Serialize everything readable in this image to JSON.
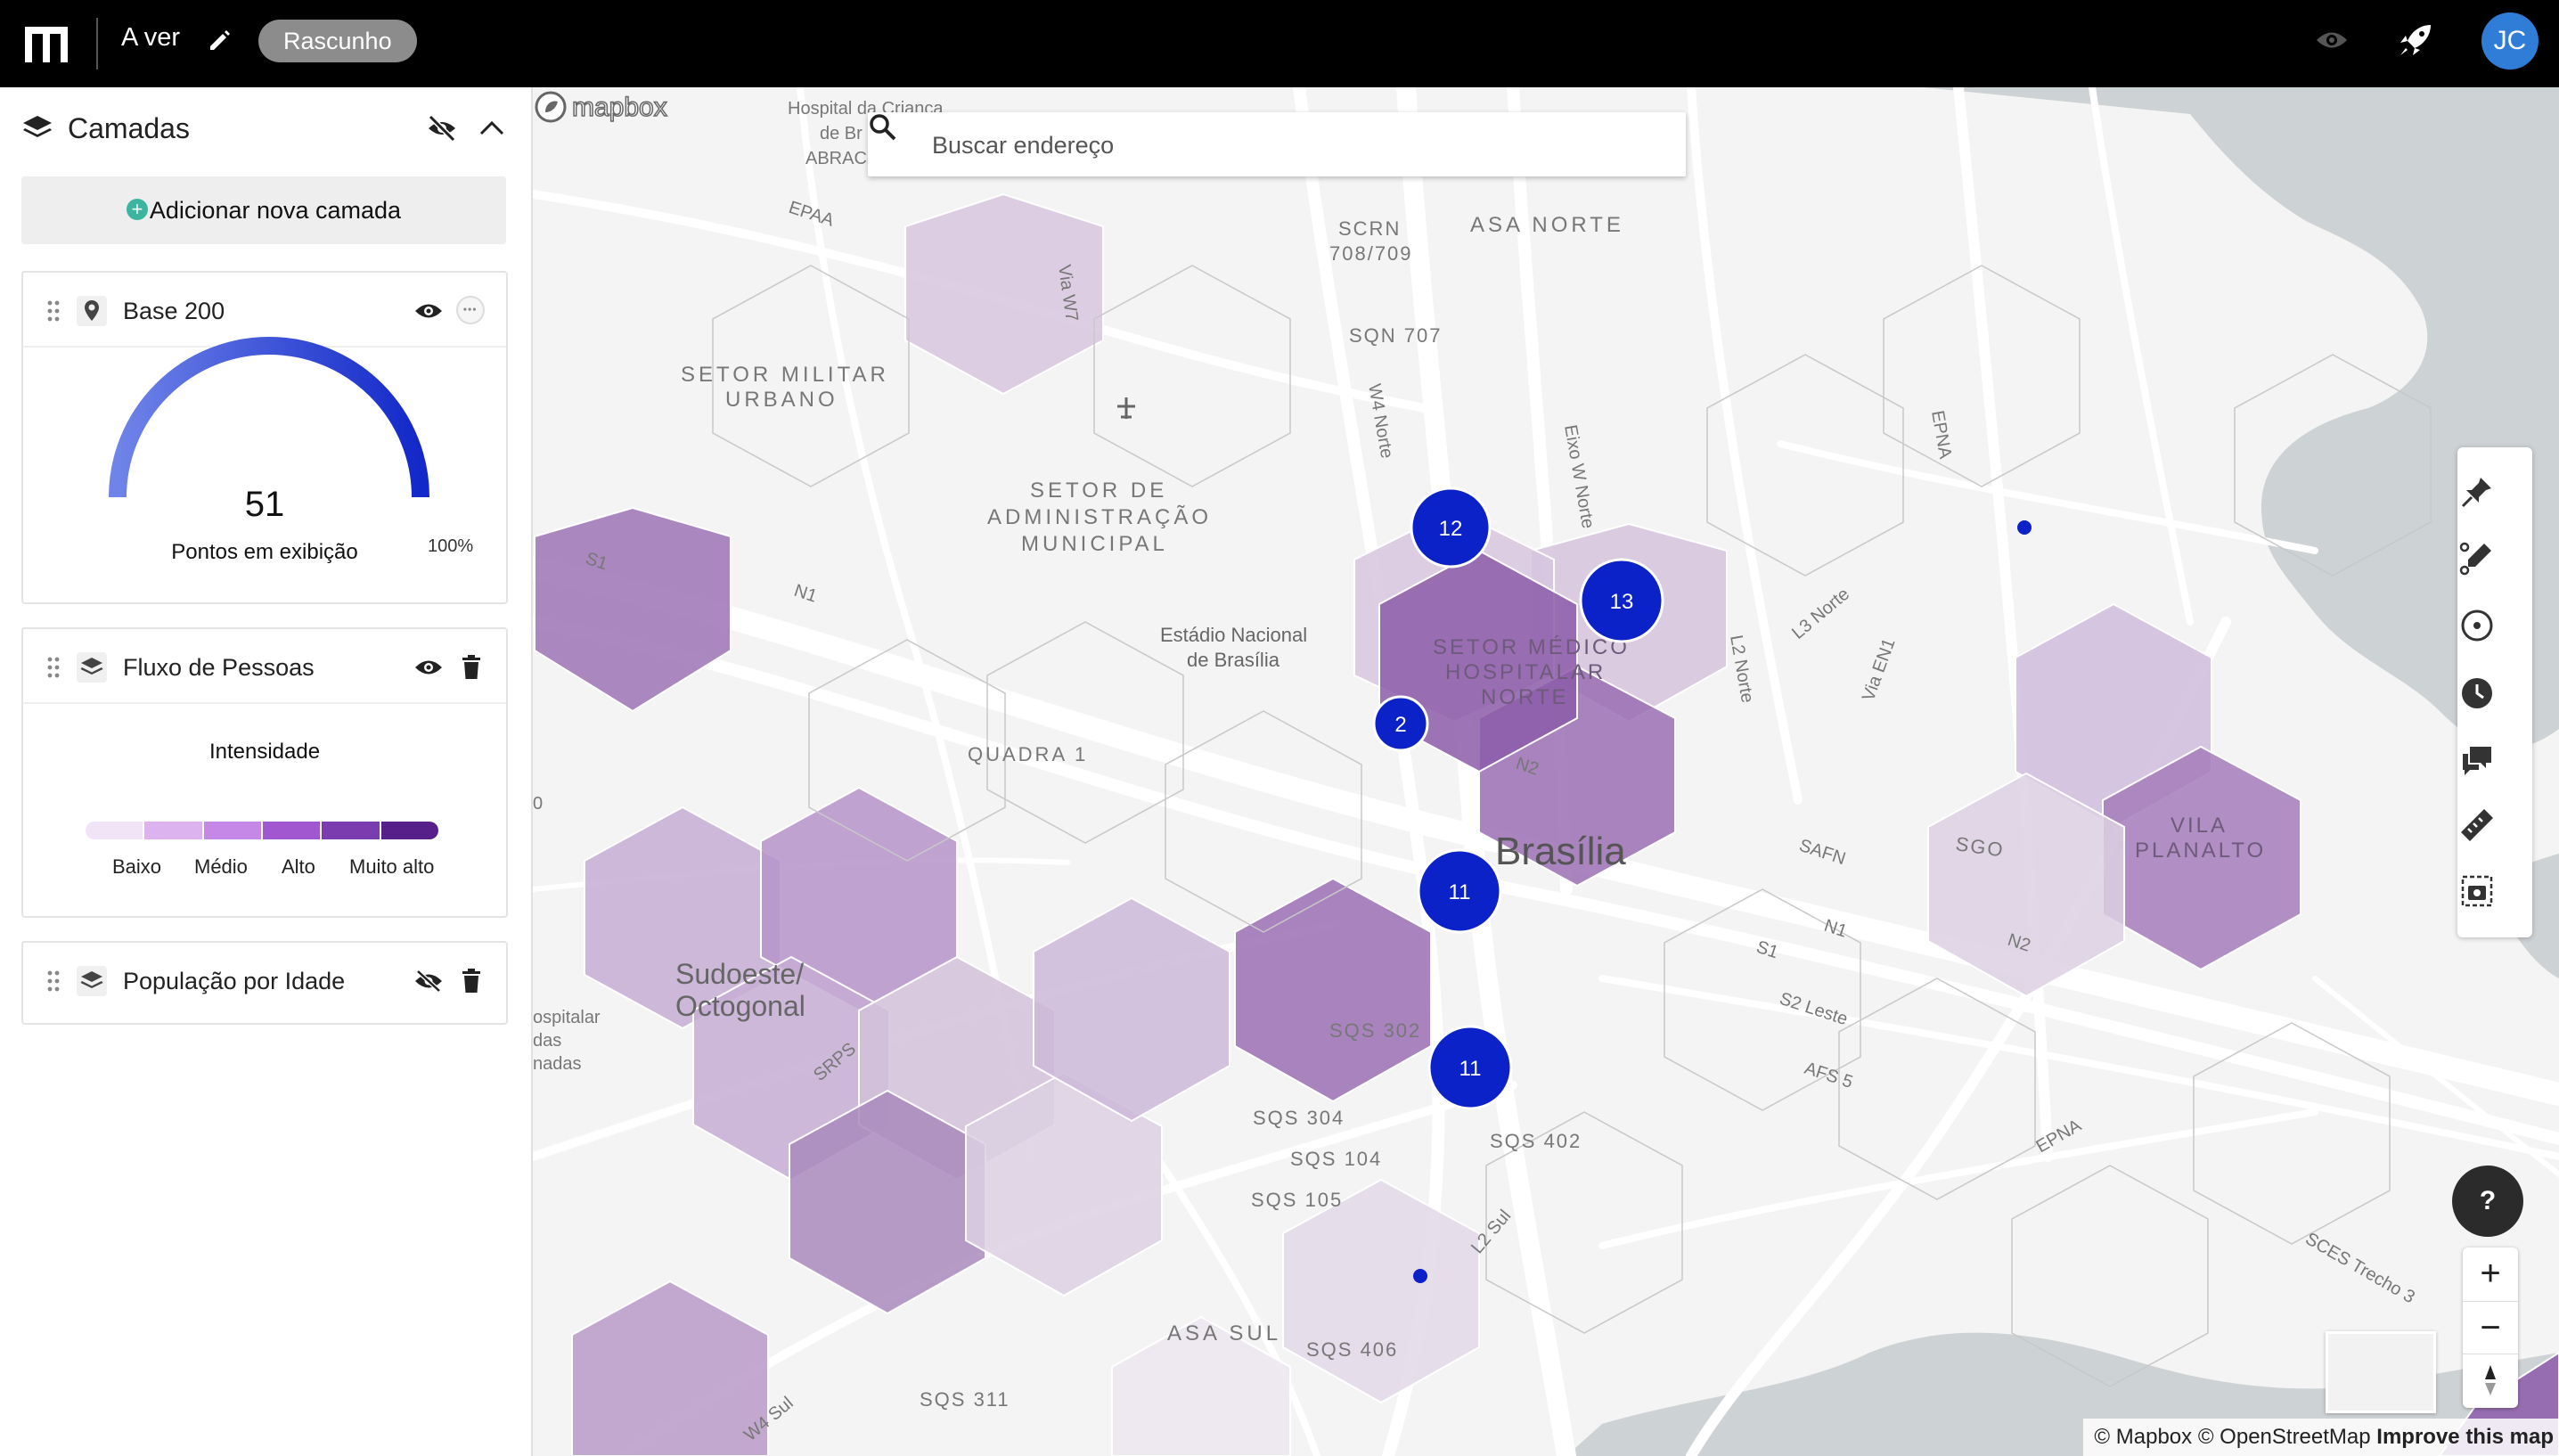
{
  "topbar": {
    "project_title": "A ver",
    "status": "Rascunho",
    "user_initials": "JC"
  },
  "sidebar": {
    "title": "Camadas",
    "add_layer_label": "Adicionar nova camada",
    "layers": [
      {
        "name": "Base 200",
        "type_icon": "pin-icon",
        "visible": true,
        "gauge": {
          "value": "51",
          "caption": "Pontos em exibição",
          "max_label": "100%",
          "fill_fraction": 1.0
        }
      },
      {
        "name": "Fluxo de Pessoas",
        "type_icon": "layers-icon",
        "visible": true,
        "legend": {
          "title": "Intensidade",
          "labels": [
            "Baixo",
            "Médio",
            "Alto",
            "Muito alto"
          ],
          "colors": [
            "#f1e4f7",
            "#dcb3ef",
            "#c688e6",
            "#a057cf",
            "#7a3cae",
            "#561f8a"
          ]
        }
      },
      {
        "name": "População por Idade",
        "type_icon": "layers-icon",
        "visible": false
      }
    ]
  },
  "map": {
    "search_placeholder": "Buscar endereço",
    "labels": {
      "brasilia": "Brasília",
      "sudoeste_1": "Sudoeste/",
      "sudoeste_2": "Octogonal",
      "asa_norte": "ASA NORTE",
      "asa_sul": "ASA SUL",
      "setor_militar_1": "SETOR MILITAR",
      "setor_militar_2": "URBANO",
      "setor_adm_1": "SETOR DE",
      "setor_adm_2": "ADMINISTRAÇÃO",
      "setor_adm_3": "MUNICIPAL",
      "setor_med_1": "SETOR MÉDICO",
      "setor_med_2": "HOSPITALAR",
      "setor_med_3": "NORTE",
      "estadio_1": "Estádio Nacional",
      "estadio_2": "de Brasília",
      "hospital_1": "Hospital da Criança",
      "hospital_2": "de Br",
      "hospital_3": "ABRAC",
      "quadra1": "QUADRA 1",
      "vila_1": "VILA",
      "vila_2": "PLANALTO",
      "sqn707": "SQN 707",
      "scrn_1": "SCRN",
      "scrn_2": "708/709",
      "sqs302": "SQS 302",
      "sqs304": "SQS 304",
      "sqs104": "SQS 104",
      "sqs105": "SQS 105",
      "sqs402": "SQS 402",
      "sqs406": "SQS 406",
      "sqs311": "SQS 311",
      "hospitalar_1": "ospitalar",
      "hospitalar_2": "das",
      "hospitalar_3": "nadas",
      "epaa": "EPAA",
      "via_w7": "Via W7",
      "w4_norte": "W4 Norte",
      "eixo_w_norte": "Eixo W Norte",
      "epna": "EPNA",
      "l3_norte": "L3 Norte",
      "l2_norte": "L2 Norte",
      "via_en1": "Via EN1",
      "s1": "S1",
      "n1": "N1",
      "n2": "N2",
      "safn": "SAFN",
      "s2_leste": "S2 Leste",
      "afs5": "AFS 5",
      "epna_south": "EPNA",
      "l2_sul": "L2 Sul",
      "srps": "SRPS",
      "w4_sul": "W4 Sul",
      "sgo": "SGO",
      "sces": "SCES Trecho 3",
      "zero": "0"
    },
    "clusters": [
      {
        "count": "12"
      },
      {
        "count": "13"
      },
      {
        "count": "2"
      },
      {
        "count": "11"
      },
      {
        "count": "11"
      }
    ],
    "attribution": {
      "text": "© Mapbox © OpenStreetMap",
      "improve": "Improve this map"
    },
    "mapbox_label": "mapbox",
    "help_label": "?"
  },
  "colors": {
    "cluster": "#0a22c7",
    "hex_light": "#c9aed6",
    "hex_mid": "#a47bba",
    "hex_dark": "#8b5aa8",
    "water": "#cdd2d4"
  }
}
